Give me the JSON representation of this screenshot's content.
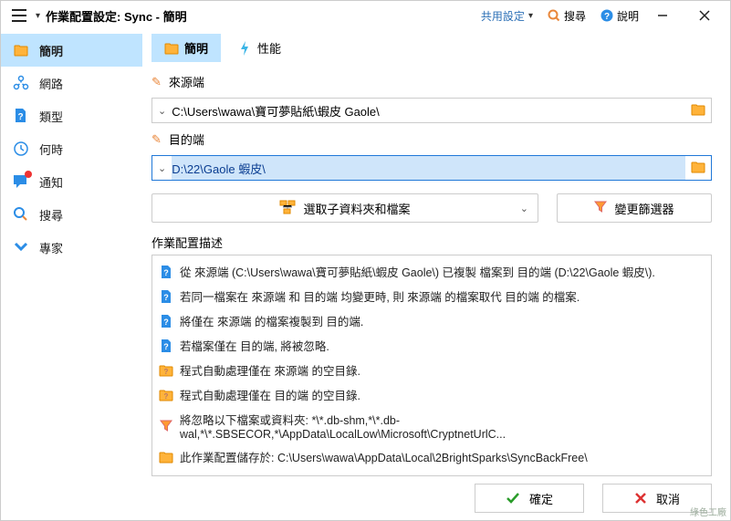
{
  "titlebar": {
    "title": "作業配置設定: Sync - 簡明",
    "share_label": "共用設定",
    "search_label": "搜尋",
    "help_label": "說明"
  },
  "sidebar": {
    "items": [
      {
        "label": "簡明"
      },
      {
        "label": "網路"
      },
      {
        "label": "類型"
      },
      {
        "label": "何時"
      },
      {
        "label": "通知"
      },
      {
        "label": "搜尋"
      },
      {
        "label": "專家"
      }
    ]
  },
  "tabs": {
    "items": [
      {
        "label": "簡明"
      },
      {
        "label": "性能"
      }
    ]
  },
  "source": {
    "label": "來源端",
    "path": "C:\\Users\\wawa\\寶可夢貼紙\\蝦皮 Gaole\\"
  },
  "dest": {
    "label": "目的端",
    "path": "D:\\22\\Gaole 蝦皮\\"
  },
  "buttons": {
    "choose": "選取子資料夾和檔案",
    "filter": "變更篩選器"
  },
  "desc": {
    "label": "作業配置描述",
    "lines": [
      "從 來源端 (C:\\Users\\wawa\\寶可夢貼紙\\蝦皮 Gaole\\) 已複製 檔案到 目的端 (D:\\22\\Gaole 蝦皮\\).",
      "若同一檔案在 來源端 和 目的端 均變更時, 則 來源端 的檔案取代 目的端 的檔案.",
      "將僅在 來源端 的檔案複製到 目的端.",
      "若檔案僅在 目的端, 將被忽略.",
      "程式自動處理僅在 來源端 的空目錄.",
      "程式自動處理僅在 目的端 的空目錄.",
      "將忽略以下檔案或資料夾: *\\*.db-shm,*\\*.db-wal,*\\*.SBSECOR,*\\AppData\\LocalLow\\Microsoft\\CryptnetUrlC...",
      "此作業配置儲存於: C:\\Users\\wawa\\AppData\\Local\\2BrightSparks\\SyncBackFree\\"
    ]
  },
  "footer": {
    "ok": "確定",
    "cancel": "取消"
  },
  "watermark": "綠色工廠"
}
